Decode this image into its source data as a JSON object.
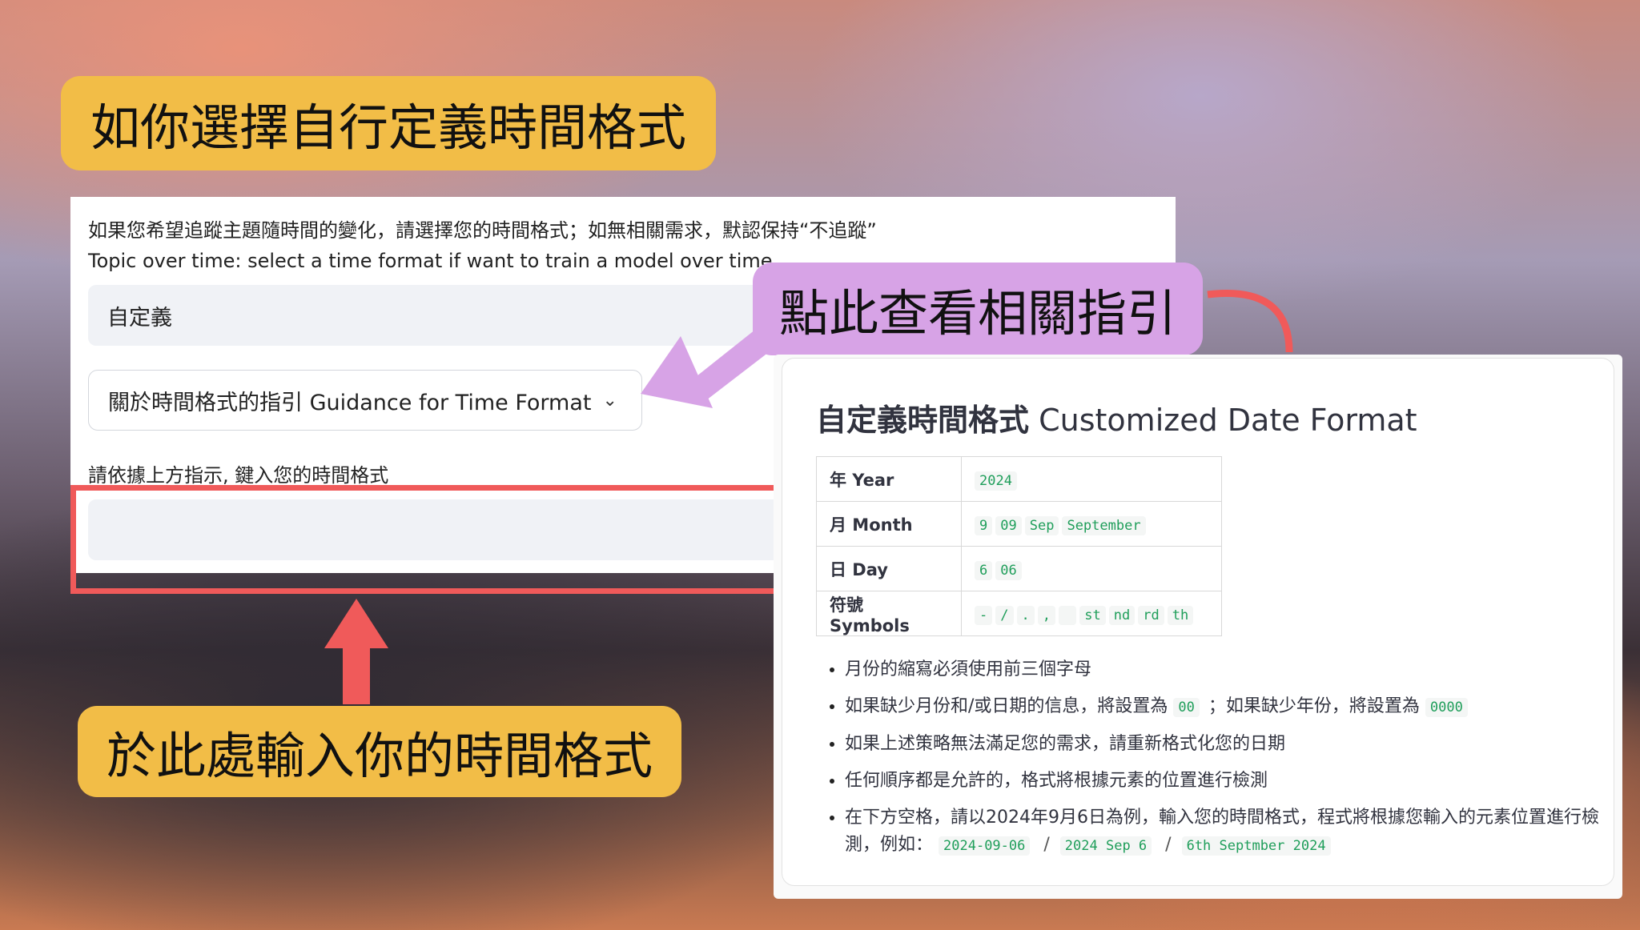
{
  "callouts": {
    "custom_format": "如你選擇自行定義時間格式",
    "view_guide": "點此查看相關指引",
    "enter_here": "於此處輸入你的時間格式"
  },
  "form": {
    "hint_zh": "如果您希望追蹤主題隨時間的變化，請選擇您的時間格式；如無相關需求，默認保持“不追蹤”",
    "hint_en": "Topic over time: select a time format if want to train a model over time.",
    "selected_value": "自定義",
    "guidance_label": "關於時間格式的指引 Guidance for Time Format",
    "input_label": "請依據上方指示, 鍵入您的時間格式",
    "input_value": ""
  },
  "guide": {
    "title_zh": "自定義時間格式",
    "title_en": "Customized Date Format",
    "rows": [
      {
        "label": "年 Year",
        "codes": [
          "2024"
        ]
      },
      {
        "label": "月 Month",
        "codes": [
          "9",
          "09",
          "Sep",
          "September"
        ]
      },
      {
        "label": "日 Day",
        "codes": [
          "6",
          "06"
        ]
      },
      {
        "label": "符號 Symbols",
        "codes": [
          "-",
          "/",
          ".",
          ",",
          " ",
          "st",
          "nd",
          "rd",
          "th"
        ]
      }
    ],
    "notes": {
      "n1": "月份的縮寫必須使用前三個字母",
      "n2_a": "如果缺少月份和/或日期的信息，將設置為",
      "n2_code1": "00",
      "n2_b": "；如果缺少年份，將設置為",
      "n2_code2": "0000",
      "n3": "如果上述策略無法滿足您的需求，請重新格式化您的日期",
      "n4": "任何順序都是允許的，格式將根據元素的位置進行檢測",
      "n5_a": "在下方空格，請以2024年9月6日為例，輸入您的時間格式，程式將根據您輸入的元素位置進行檢測，例如：",
      "n5_ex1": "2024-09-06",
      "n5_sep": "/",
      "n5_ex2": "2024 Sep 6",
      "n5_ex3": "6th Septmber 2024"
    }
  },
  "colors": {
    "callout_yellow": "#f2bd47",
    "callout_purple": "#d7a3e6",
    "highlight_red": "#f05a5a",
    "code_green": "#1f9e5a"
  }
}
